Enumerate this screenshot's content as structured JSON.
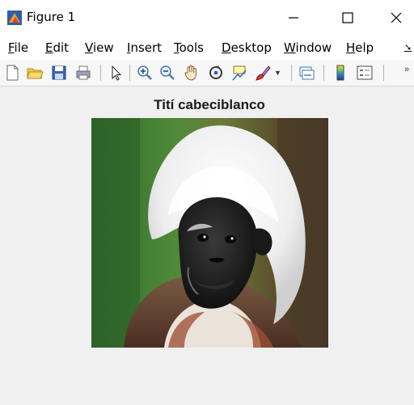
{
  "window": {
    "title": "Figure 1",
    "icon": "matlab-figure-icon",
    "controls": [
      "minimize-icon",
      "maximize-icon",
      "close-icon"
    ]
  },
  "menu": {
    "items": [
      {
        "label": "File"
      },
      {
        "label": "Edit"
      },
      {
        "label": "View"
      },
      {
        "label": "Insert"
      },
      {
        "label": "Tools"
      },
      {
        "label": "Desktop"
      },
      {
        "label": "Window"
      },
      {
        "label": "Help"
      }
    ]
  },
  "toolbar": {
    "buttons": [
      "new-figure-icon",
      "open-file-icon",
      "save-icon",
      "print-icon",
      "edit-plot-icon",
      "zoom-in-icon",
      "zoom-out-icon",
      "pan-icon",
      "rotate-3d-icon",
      "data-cursor-icon",
      "brush-icon",
      "link-plot-icon",
      "colorbar-icon",
      "legend-icon",
      "overflow-icon"
    ]
  },
  "figure": {
    "title": "Tití cabeciblanco",
    "image_subject": "cotton-top tamarin"
  },
  "colors": {
    "figure_background": "#f0f0f0",
    "window_chrome": "#ffffff"
  }
}
